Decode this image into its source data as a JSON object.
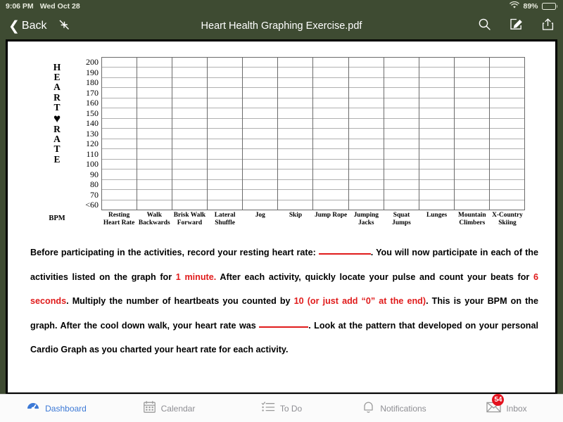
{
  "status_bar": {
    "time": "9:06 PM",
    "date": "Wed Oct 28",
    "battery_percent": "89%",
    "wifi_icon": "wifi-icon",
    "battery_icon": "battery-icon"
  },
  "nav_bar": {
    "back_label": "Back",
    "title": "Heart Health Graphing Exercise.pdf",
    "collapse_icon": "collapse-arrows-icon",
    "search_icon": "search-icon",
    "markup_icon": "markup-pencil-icon",
    "share_icon": "share-icon"
  },
  "document": {
    "axis_title_letters": [
      "H",
      "E",
      "A",
      "R",
      "T",
      "♥",
      "R",
      "A",
      "T",
      "E"
    ],
    "bpm_label": "BPM",
    "paragraph": {
      "s1": "Before participating in the activities, record your resting heart rate: ",
      "s2": ". You will now participate in each of the activities listed on the graph for ",
      "r1": "1 minute.",
      "s3": " After each activity, quickly locate your pulse and count your beats for ",
      "r2": "6 seconds",
      "s4": ". Multiply the number of heartbeats you counted by ",
      "r3": "10 (or just add “0” at the end)",
      "s5": ". This is your BPM on the graph. After the cool down walk, your heart rate was ",
      "s6": ". Look at the pattern that developed on your personal Cardio Graph as you charted your heart rate for each activity.",
      "blank_1": "",
      "blank_2": ""
    }
  },
  "chart_data": {
    "type": "bar",
    "title": "Heart Health Graphing Exercise",
    "xlabel": "",
    "ylabel": "HEART ♥ RATE",
    "yunit": "BPM",
    "categories": [
      "Resting Heart Rate",
      "Walk Backwards",
      "Brisk Walk Forward",
      "Lateral Shuffle",
      "Jog",
      "Skip",
      "Jump Rope",
      "Jumping Jacks",
      "Squat Jumps",
      "Lunges",
      "Mountain Climbers",
      "X-Country Skiing"
    ],
    "values": [
      null,
      null,
      null,
      null,
      null,
      null,
      null,
      null,
      null,
      null,
      null,
      null
    ],
    "yticks": [
      "200",
      "190",
      "180",
      "170",
      "160",
      "150",
      "140",
      "130",
      "120",
      "110",
      "100",
      "90",
      "80",
      "70",
      "<60"
    ],
    "ylim": [
      60,
      200
    ],
    "grid": true,
    "legend": false,
    "note": "Blank worksheet grid — no data plotted"
  },
  "tab_bar": {
    "active_color": "#3c79d6",
    "inactive_color": "#8e8e93",
    "tabs": [
      {
        "label": "Dashboard",
        "icon": "dashboard-gauge-icon",
        "active": true,
        "badge": ""
      },
      {
        "label": "Calendar",
        "icon": "calendar-icon",
        "active": false,
        "badge": ""
      },
      {
        "label": "To Do",
        "icon": "todo-checklist-icon",
        "active": false,
        "badge": ""
      },
      {
        "label": "Notifications",
        "icon": "bell-icon",
        "active": false,
        "badge": ""
      },
      {
        "label": "Inbox",
        "icon": "envelope-icon",
        "active": false,
        "badge": "54"
      }
    ]
  },
  "colors": {
    "nav_background": "#3e4b32",
    "accent_red": "#e01b1b",
    "badge_red": "#e4121e",
    "tab_active": "#3c79d6"
  }
}
